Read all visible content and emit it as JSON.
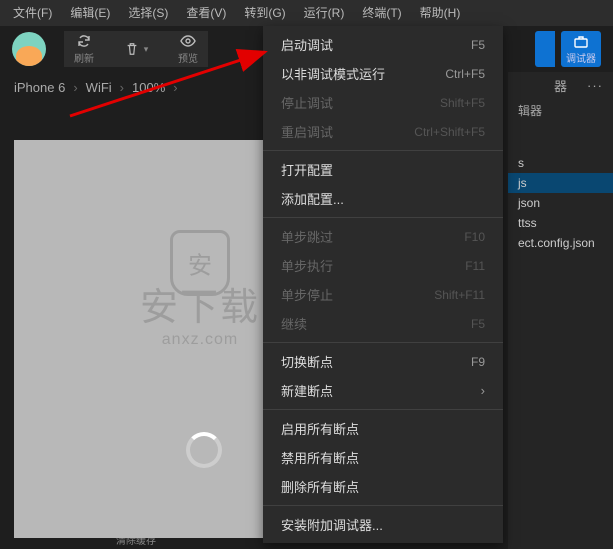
{
  "menubar": [
    {
      "label": "文件(F)"
    },
    {
      "label": "编辑(E)"
    },
    {
      "label": "选择(S)"
    },
    {
      "label": "查看(V)"
    },
    {
      "label": "转到(G)"
    },
    {
      "label": "运行(R)"
    },
    {
      "label": "终端(T)"
    },
    {
      "label": "帮助(H)"
    }
  ],
  "toolbar": {
    "refresh": "刷新",
    "clear_cache": "清除缓存",
    "preview": "预览",
    "debugger": "调试器"
  },
  "breadcrumb": [
    {
      "text": "iPhone 6"
    },
    {
      "text": "WiFi"
    },
    {
      "text": "100%"
    }
  ],
  "right_panel": {
    "tab1": "器",
    "tab2": "辑器",
    "files": [
      "s",
      "js",
      "json",
      "ttss",
      "ect.config.json"
    ],
    "selected_index": 1
  },
  "dropdown": {
    "groups": [
      [
        {
          "label": "启动调试",
          "shortcut": "F5",
          "disabled": false
        },
        {
          "label": "以非调试模式运行",
          "shortcut": "Ctrl+F5",
          "disabled": false
        },
        {
          "label": "停止调试",
          "shortcut": "Shift+F5",
          "disabled": true
        },
        {
          "label": "重启调试",
          "shortcut": "Ctrl+Shift+F5",
          "disabled": true
        }
      ],
      [
        {
          "label": "打开配置",
          "shortcut": "",
          "disabled": false
        },
        {
          "label": "添加配置...",
          "shortcut": "",
          "disabled": false
        }
      ],
      [
        {
          "label": "单步跳过",
          "shortcut": "F10",
          "disabled": true
        },
        {
          "label": "单步执行",
          "shortcut": "F11",
          "disabled": true
        },
        {
          "label": "单步停止",
          "shortcut": "Shift+F11",
          "disabled": true
        },
        {
          "label": "继续",
          "shortcut": "F5",
          "disabled": true
        }
      ],
      [
        {
          "label": "切换断点",
          "shortcut": "F9",
          "disabled": false
        },
        {
          "label": "新建断点",
          "shortcut": "",
          "submenu": true,
          "disabled": false
        }
      ],
      [
        {
          "label": "启用所有断点",
          "shortcut": "",
          "disabled": false
        },
        {
          "label": "禁用所有断点",
          "shortcut": "",
          "disabled": false
        },
        {
          "label": "删除所有断点",
          "shortcut": "",
          "disabled": false
        }
      ],
      [
        {
          "label": "安装附加调试器...",
          "shortcut": "",
          "disabled": false
        }
      ]
    ]
  },
  "watermark": {
    "text": "安下载",
    "url": "anxz.com"
  }
}
